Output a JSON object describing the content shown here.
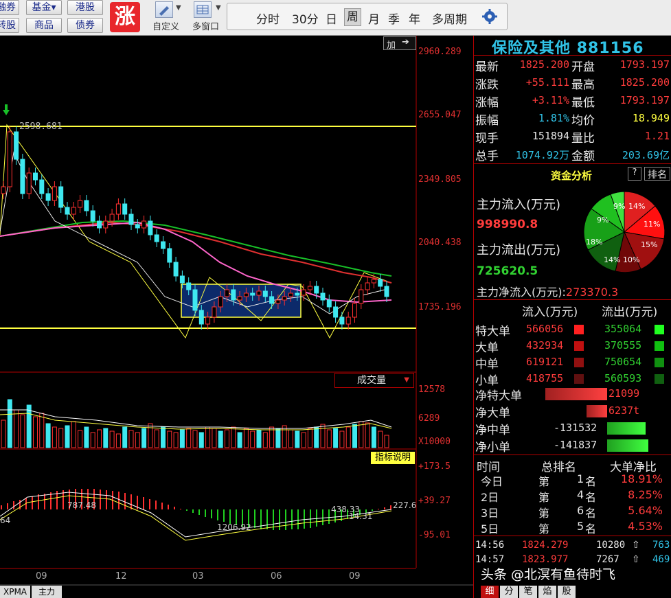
{
  "toolbar": {
    "left_buttons": [
      "融券",
      "基金▾",
      "港股",
      "转股",
      "商品",
      "债券"
    ],
    "zhang_label": "涨",
    "custom_label": "自定义",
    "multiwin_label": "多窗口",
    "close_label": "✕",
    "periods": [
      "分时",
      "30分",
      "日",
      "周",
      "月",
      "季",
      "年",
      "多周期"
    ],
    "selected_period": "周"
  },
  "chart": {
    "add_label": "加",
    "peak_label": "2598.681",
    "y_labels": [
      "2960.289",
      "2655.047",
      "2349.805",
      "2040.438",
      "1735.196"
    ],
    "x_labels": [
      "09",
      "12",
      "03",
      "06",
      "09"
    ],
    "volume_label": "成交量",
    "vol_y": [
      "12578",
      "6289",
      "X10000"
    ],
    "indicator_label": "指标说明",
    "macd_y": [
      "+173.5",
      "+39.27",
      "-95.01"
    ],
    "macd_labels": [
      "787.48",
      "1206.92",
      "438.33",
      "14.31",
      "227.6",
      "64"
    ],
    "bottom_tabs": [
      "XPMA",
      "主力"
    ]
  },
  "stock": {
    "name": "保险及其他",
    "code": "881156"
  },
  "quote": [
    {
      "l1": "最新",
      "v1": "1825.200",
      "c1": "red",
      "l2": "开盘",
      "v2": "1793.197",
      "c2": "red"
    },
    {
      "l1": "涨跌",
      "v1": "+55.111",
      "c1": "red",
      "l2": "最高",
      "v2": "1825.200",
      "c2": "red"
    },
    {
      "l1": "涨幅",
      "v1": "+3.11%",
      "c1": "red",
      "l2": "最低",
      "v2": "1793.197",
      "c2": "red"
    },
    {
      "l1": "振幅",
      "v1": "1.81%",
      "c1": "cy",
      "l2": "均价",
      "v2": "18.949",
      "c2": "yel"
    },
    {
      "l1": "现手",
      "v1": "151894",
      "c1": "wh",
      "l2": "量比",
      "v2": "1.21",
      "c2": "red"
    },
    {
      "l1": "总手",
      "v1": "1074.92万",
      "c1": "cy",
      "l2": "金额",
      "v2": "203.69亿",
      "c2": "cy"
    }
  ],
  "fund": {
    "title": "资金分析",
    "help": "?",
    "rank": "排名",
    "inflow_label": "主力流入(万元)",
    "inflow_value": "998990.8",
    "outflow_label": "主力流出(万元)",
    "outflow_value": "725620.5",
    "net_label": "主力净流入(万元):",
    "net_value": "273370.3",
    "pie": [
      "9%",
      "9%",
      "14%",
      "11%",
      "15%",
      "10%",
      "14%",
      "18%"
    ],
    "in_header": "流入(万元)",
    "out_header": "流出(万元)",
    "rows": [
      {
        "label": "特大单",
        "in": "566056",
        "out": "355064"
      },
      {
        "label": "大单",
        "in": "432934",
        "out": "370555"
      },
      {
        "label": "中单",
        "in": "619121",
        "out": "750654"
      },
      {
        "label": "小单",
        "in": "418755",
        "out": "560593"
      }
    ],
    "net_rows": [
      {
        "label": "净特大单",
        "value": "21099",
        "frac": 0.15
      },
      {
        "label": "净大单",
        "value": "6237t",
        "frac": 0.05
      },
      {
        "label": "净中单",
        "value": "-131532",
        "frac": 0.93
      },
      {
        "label": "净小单",
        "value": "-141837",
        "frac": 1.0
      }
    ]
  },
  "rank": {
    "headers": [
      "时间",
      "总排名",
      "大单净比"
    ],
    "rows": [
      {
        "t": "今日",
        "pre": "第",
        "n": "1",
        "suf": "名",
        "pct": "18.91%"
      },
      {
        "t": "2日",
        "pre": "第",
        "n": "4",
        "suf": "名",
        "pct": "8.25%"
      },
      {
        "t": "3日",
        "pre": "第",
        "n": "6",
        "suf": "名",
        "pct": "5.64%"
      },
      {
        "t": "5日",
        "pre": "第",
        "n": "5",
        "suf": "名",
        "pct": "4.53%"
      }
    ]
  },
  "ticks": [
    {
      "time": "14:56",
      "price": "1824.279",
      "vol": "10280",
      "arrow": "⇧",
      "extra": "763"
    },
    {
      "time": "14:57",
      "price": "1823.977",
      "vol": "7267",
      "arrow": "⇧",
      "extra": "469"
    }
  ],
  "bottom_tabs": [
    "细",
    "分",
    "笔",
    "焰",
    "股"
  ],
  "watermark": "头条 @北溟有鱼待时飞"
}
